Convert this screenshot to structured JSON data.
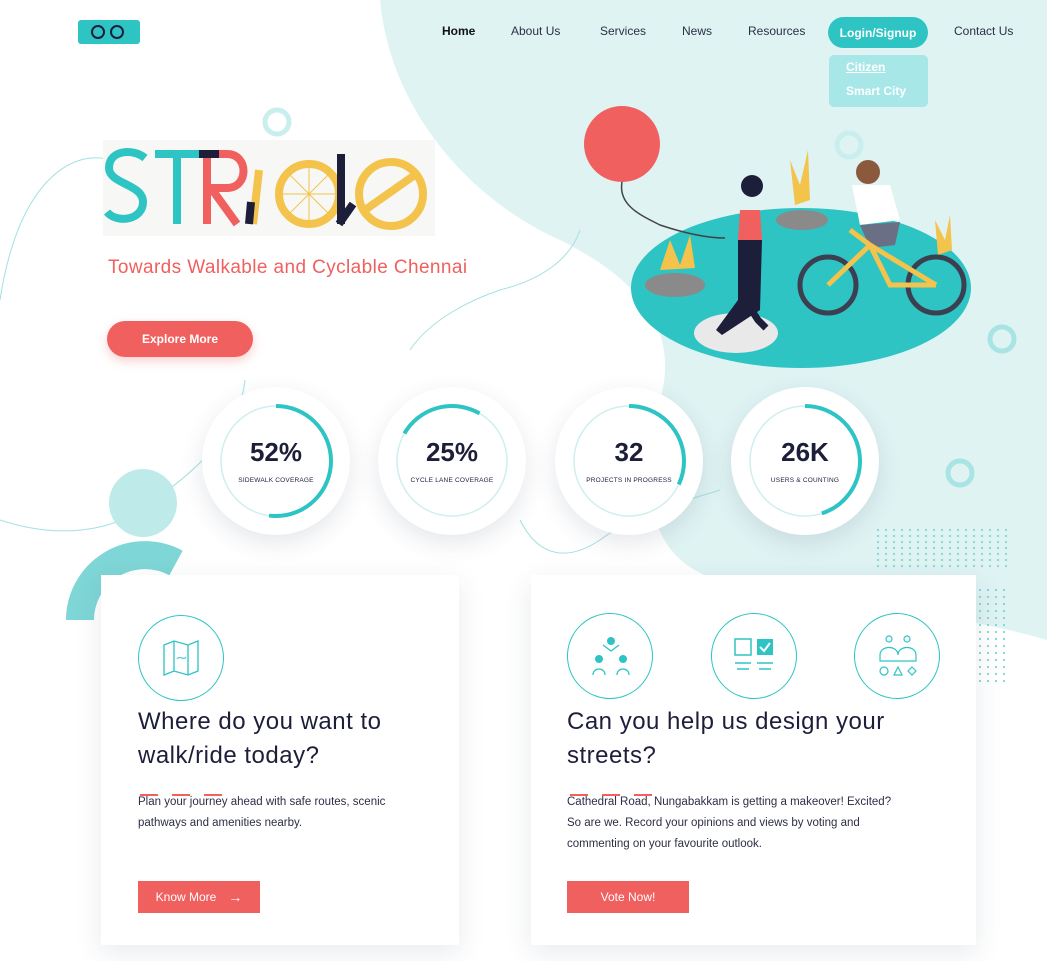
{
  "nav": {
    "items": [
      "Home",
      "About Us",
      "Services",
      "News",
      "Resources"
    ],
    "login_label": "Login/Signup",
    "contact_label": "Contact Us",
    "dropdown": [
      "Citizen",
      "Smart City"
    ]
  },
  "hero": {
    "brand": "STRiDe",
    "tagline": "Towards Walkable and Cyclable Chennai",
    "explore_label": "Explore More"
  },
  "stats": [
    {
      "value": "52%",
      "label": "SIDEWALK COVERAGE",
      "progress": 0.52
    },
    {
      "value": "25%",
      "label": "CYCLE LANE COVERAGE",
      "progress": 0.25
    },
    {
      "value": "32",
      "label": "PROJECTS IN PROGRESS",
      "progress": 0.32
    },
    {
      "value": "26K",
      "label": "USERS & COUNTING",
      "progress": 0.45
    }
  ],
  "cards": {
    "plan": {
      "title_line1": "Where do you want to",
      "title_line2": "walk/ride today?",
      "text_line1": "Plan your journey ahead with safe routes, scenic",
      "text_line2": "pathways and amenities nearby.",
      "button_label": "Know More",
      "icon": "map-icon"
    },
    "design": {
      "title_line1": "Can you help us design your",
      "title_line2": "streets?",
      "text_line1": "Cathedral Road, Nungabakkam is getting a makeover! Excited?",
      "text_line2": "So are we. Record your opinions and views by voting and",
      "text_line3": "commenting on your favourite outlook.",
      "button_label": "Vote Now!",
      "icons": [
        "community-icon",
        "vote-checkbox-icon",
        "people-shapes-icon"
      ]
    }
  },
  "colors": {
    "accent_teal": "#2ec4c4",
    "accent_coral": "#f0605f",
    "dark_text": "#1d1f3a"
  }
}
